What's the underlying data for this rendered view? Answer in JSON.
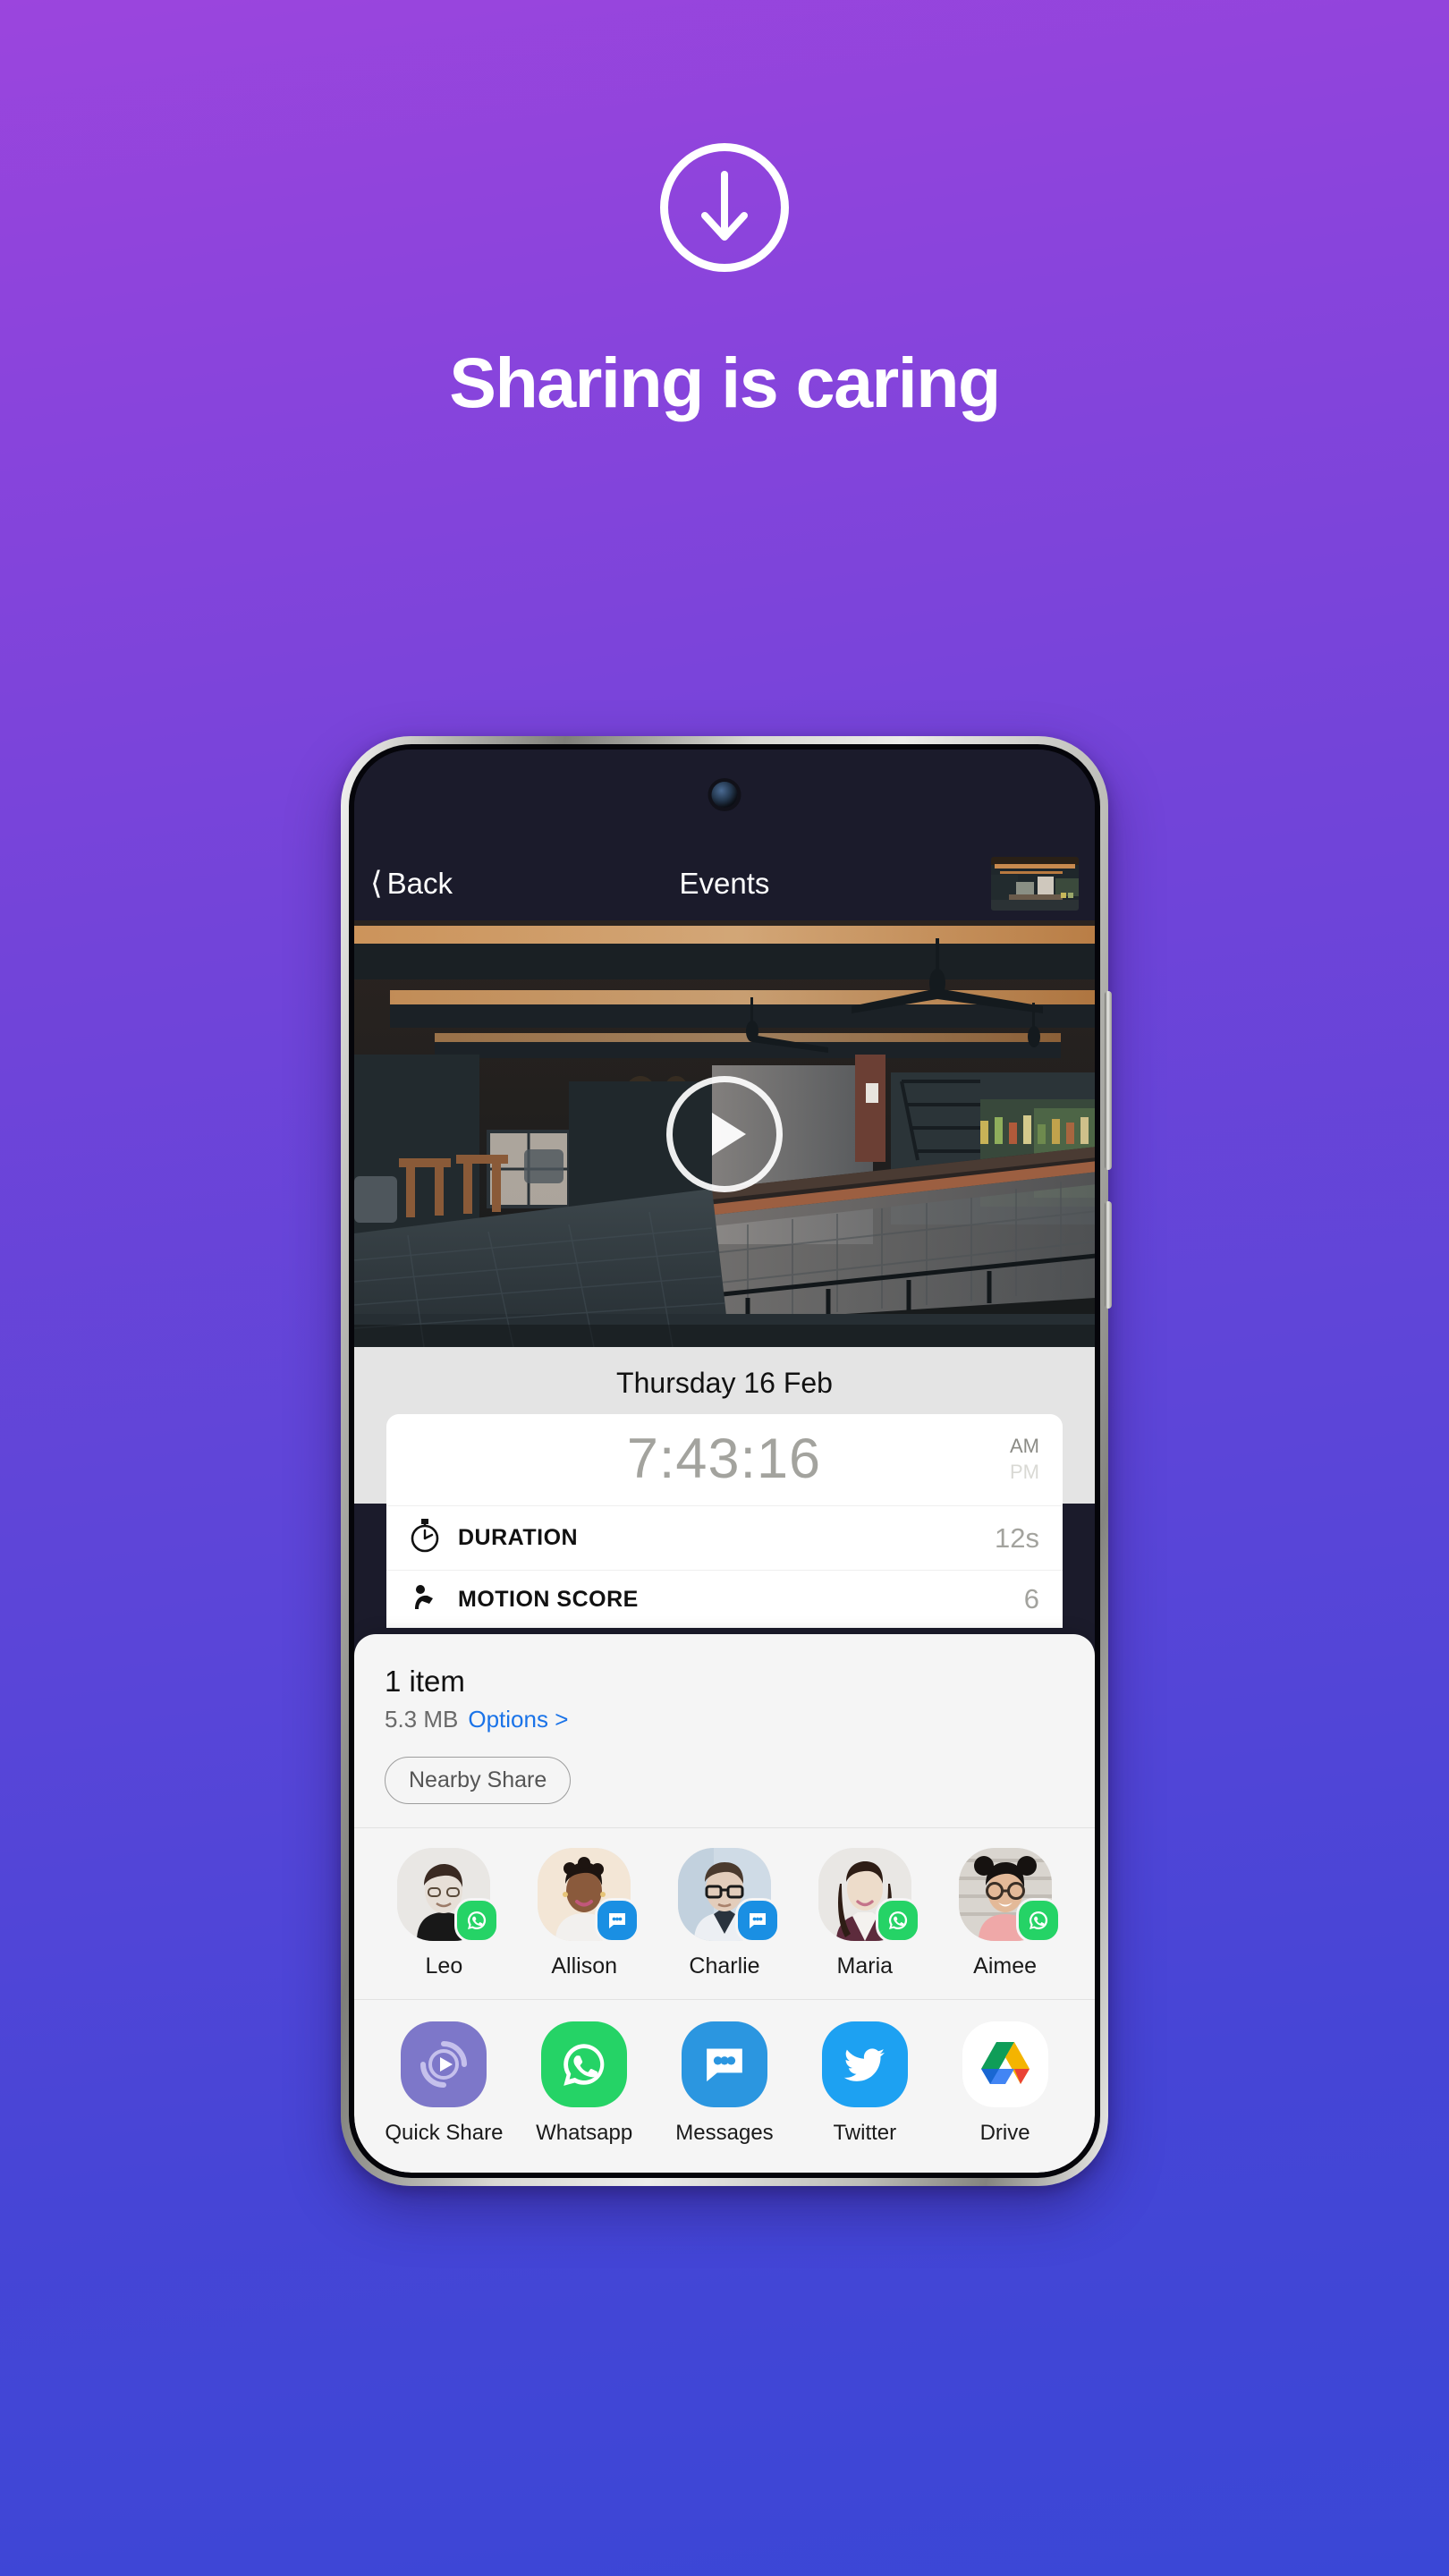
{
  "promo": {
    "icon": "download-arrow-circle-icon",
    "title": "Sharing is caring"
  },
  "phone": {
    "nav": {
      "back_label": "Back",
      "back_icon": "chevron-left-icon",
      "title": "Events",
      "thumbnail_alt": "restaurant-interior-thumbnail"
    },
    "media": {
      "play_icon": "play-circle-icon",
      "alt": "dark-industrial-bar-interior"
    },
    "detail": {
      "date": "Thursday 16 Feb",
      "time": "7:43:16",
      "am_label": "AM",
      "pm_label": "PM",
      "active_meridiem": "AM",
      "rows": [
        {
          "icon": "stopwatch-icon",
          "label": "DURATION",
          "value": "12s"
        },
        {
          "icon": "motion-icon",
          "label": "MOTION SCORE",
          "value": "6"
        }
      ]
    },
    "share_sheet": {
      "item_count": "1 item",
      "size": "5.3 MB",
      "options_label": "Options >",
      "nearby_share_label": "Nearby Share",
      "contacts": [
        {
          "name": "Leo",
          "badge": "whatsapp-icon",
          "badge_type": "wa",
          "skin": "#e7dfd7",
          "hair": "#3a2a22",
          "shirt": "#181818",
          "bg": "#e9e7e4"
        },
        {
          "name": "Allison",
          "badge": "messages-icon",
          "badge_type": "msg",
          "skin": "#8a5a3c",
          "hair": "#1d1410",
          "shirt": "#f2f0ee",
          "bg": "#f3e6d6"
        },
        {
          "name": "Charlie",
          "badge": "messages-icon",
          "badge_type": "msg",
          "skin": "#e3cdbb",
          "hair": "#4a3a2e",
          "shirt": "#eceff3",
          "bg": "#cfdbe6"
        },
        {
          "name": "Maria",
          "badge": "whatsapp-icon",
          "badge_type": "wa",
          "skin": "#eddcca",
          "hair": "#2e1d15",
          "shirt": "#5d2b3c",
          "bg": "#e9e7e4"
        },
        {
          "name": "Aimee",
          "badge": "whatsapp-icon",
          "badge_type": "wa",
          "skin": "#e3b998",
          "hair": "#161210",
          "shirt": "#efa8a8",
          "bg": "#d9d5cf"
        }
      ],
      "apps": [
        {
          "name": "Quick Share",
          "icon": "quick-share-icon"
        },
        {
          "name": "Whatsapp",
          "icon": "whatsapp-icon"
        },
        {
          "name": "Messages",
          "icon": "messages-icon"
        },
        {
          "name": "Twitter",
          "icon": "twitter-icon"
        },
        {
          "name": "Drive",
          "icon": "google-drive-icon"
        }
      ]
    }
  },
  "colors": {
    "bg_top": "#9b45dd",
    "bg_bottom": "#3a47d6",
    "link_blue": "#1a73e8",
    "whatsapp_green": "#25d366",
    "messages_blue": "#1a8fe3",
    "twitter_blue": "#1da1f2",
    "quick_share_purple": "#7d77c9"
  }
}
